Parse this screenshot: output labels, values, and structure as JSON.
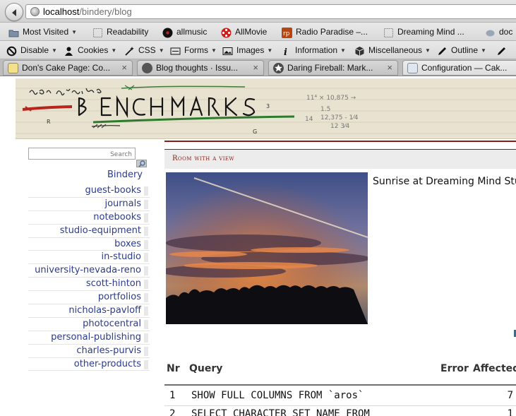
{
  "browser": {
    "url_host": "localhost",
    "url_path": "/bindery/blog",
    "bookmarks": [
      {
        "label": "Most Visited",
        "icon": "folder-icon",
        "dropdown": true
      },
      {
        "label": "Readability",
        "icon": "page-icon"
      },
      {
        "label": "allmusic",
        "icon": "record-icon"
      },
      {
        "label": "AllMovie",
        "icon": "film-reel-icon"
      },
      {
        "label": "Radio Paradise –...",
        "icon": "rp-logo-icon"
      },
      {
        "label": "Dreaming Mind ...",
        "icon": "page-icon"
      },
      {
        "label": "doc",
        "icon": "cloud-icon"
      }
    ],
    "toolbar": [
      {
        "label": "Disable",
        "icon": "no-icon"
      },
      {
        "label": "Cookies",
        "icon": "user-icon"
      },
      {
        "label": "CSS",
        "icon": "wand-icon"
      },
      {
        "label": "Forms",
        "icon": "form-icon"
      },
      {
        "label": "Images",
        "icon": "image-icon"
      },
      {
        "label": "Information",
        "icon": "info-icon"
      },
      {
        "label": "Miscellaneous",
        "icon": "cube-icon"
      },
      {
        "label": "Outline",
        "icon": "pencil-icon"
      }
    ],
    "tabs": [
      {
        "label": "Don's Cake Page: Co...",
        "icon": "cake-page-icon"
      },
      {
        "label": "Blog thoughts · Issu...",
        "icon": "github-icon"
      },
      {
        "label": "Daring Fireball: Mark...",
        "icon": "star-icon"
      },
      {
        "label": "Configuration — Cak...",
        "icon": "config-icon"
      }
    ]
  },
  "sidebar": {
    "search_placeholder": "Search",
    "category_title": "Bindery",
    "items": [
      "guest-books",
      "journals",
      "notebooks",
      "studio-equipment",
      "boxes",
      "in-studio",
      "university-nevada-reno",
      "scott-hinton",
      "portfolios",
      "nicholas-pavloff",
      "photocentral",
      "personal-publishing",
      "charles-purvis",
      "other-products"
    ]
  },
  "post": {
    "title": "Room with a view",
    "caption": "Sunrise at Dreaming Mind Stu"
  },
  "query_log": {
    "headers": {
      "nr": "Nr",
      "query": "Query",
      "error": "Error",
      "affected": "Affected"
    },
    "rows": [
      {
        "nr": "1",
        "query": "SHOW FULL COLUMNS FROM `aros`",
        "affected": "7"
      },
      {
        "nr": "2",
        "query": "SELECT CHARACTER_SET_NAME FROM",
        "affected": "1"
      }
    ]
  },
  "colors": {
    "link_blue": "#2b3b8e",
    "accent_red": "#8b1d16",
    "banner_bg": "#e8e3d1"
  }
}
